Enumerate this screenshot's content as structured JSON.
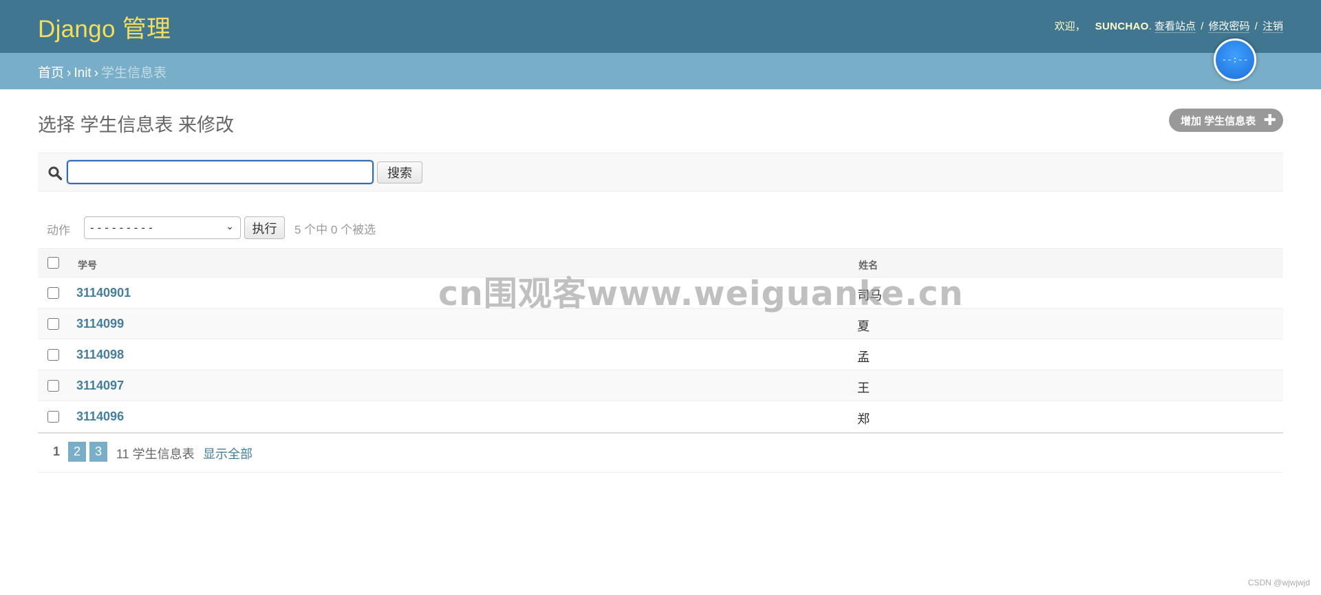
{
  "header": {
    "brand": "Django 管理",
    "welcome": "欢迎，",
    "username": "SUNCHAO",
    "view_site": "查看站点",
    "change_password": "修改密码",
    "logout": "注销",
    "period": ".",
    "separator": "/"
  },
  "breadcrumbs": {
    "home": "首页",
    "app": "Init",
    "current": "学生信息表",
    "separator": "›"
  },
  "clock": {
    "text": "--:--"
  },
  "content": {
    "title": "选择 学生信息表 来修改",
    "add_button": "增加 学生信息表",
    "add_icon": "✚"
  },
  "search": {
    "value": "",
    "placeholder": "",
    "button": "搜索"
  },
  "actions": {
    "label": "动作",
    "selected": "---------",
    "go_button": "执行",
    "counter": "5 个中 0 个被选"
  },
  "table": {
    "headers": {
      "id": "学号",
      "name": "姓名"
    },
    "rows": [
      {
        "id": "31140901",
        "name": "司马"
      },
      {
        "id": "3114099",
        "name": "夏"
      },
      {
        "id": "3114098",
        "name": "孟"
      },
      {
        "id": "3114097",
        "name": "王"
      },
      {
        "id": "3114096",
        "name": "郑"
      }
    ]
  },
  "paginator": {
    "current_page": "1",
    "pages": [
      "2",
      "3"
    ],
    "count": "11 学生信息表",
    "show_all": "显示全部"
  },
  "watermark": "cn围观客www.weiguanke.cn",
  "credit": "CSDN @wjwjwjd",
  "colors": {
    "header_bg": "#417690",
    "brand": "#f5dd5d",
    "breadcrumbs_bg": "#79aec8",
    "link": "#447e9b",
    "add_button_bg": "#999999"
  }
}
